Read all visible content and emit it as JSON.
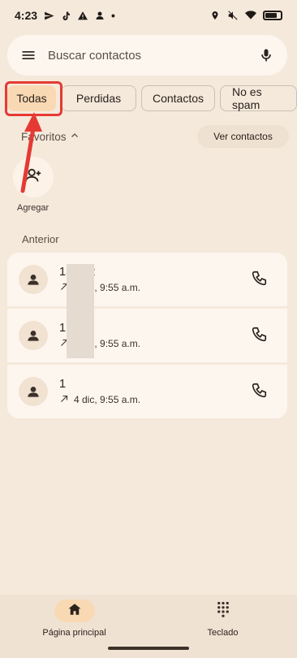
{
  "status_bar": {
    "time": "4:23",
    "dot": "•",
    "left_icons": [
      "send-icon",
      "tiktok-icon",
      "warning-icon",
      "account-icon"
    ],
    "right_icons": [
      "location-icon",
      "mute-icon",
      "wifi-icon",
      "battery-icon"
    ]
  },
  "search": {
    "placeholder": "Buscar contactos"
  },
  "chips": [
    {
      "label": "Todas",
      "active": true
    },
    {
      "label": "Perdidas",
      "active": false
    },
    {
      "label": "Contactos",
      "active": false
    },
    {
      "label": "No es spam",
      "active": false
    }
  ],
  "favorites": {
    "title": "Favoritos",
    "ver_contactos": "Ver contactos",
    "add_label": "Agregar"
  },
  "history": {
    "section_label": "Anterior",
    "calls": [
      {
        "number": "13    682",
        "detail": "4 dic, 9:55 a.m."
      },
      {
        "number": "1",
        "detail": "4 dic, 9:55 a.m."
      },
      {
        "number": "1",
        "detail": "4 dic, 9:55 a.m."
      }
    ]
  },
  "nav": {
    "home_label": "Página principal",
    "keypad_label": "Teclado"
  },
  "colors": {
    "background": "#f5e9dc",
    "accent": "#f8d9b4",
    "annotation_red": "#e53a33"
  }
}
